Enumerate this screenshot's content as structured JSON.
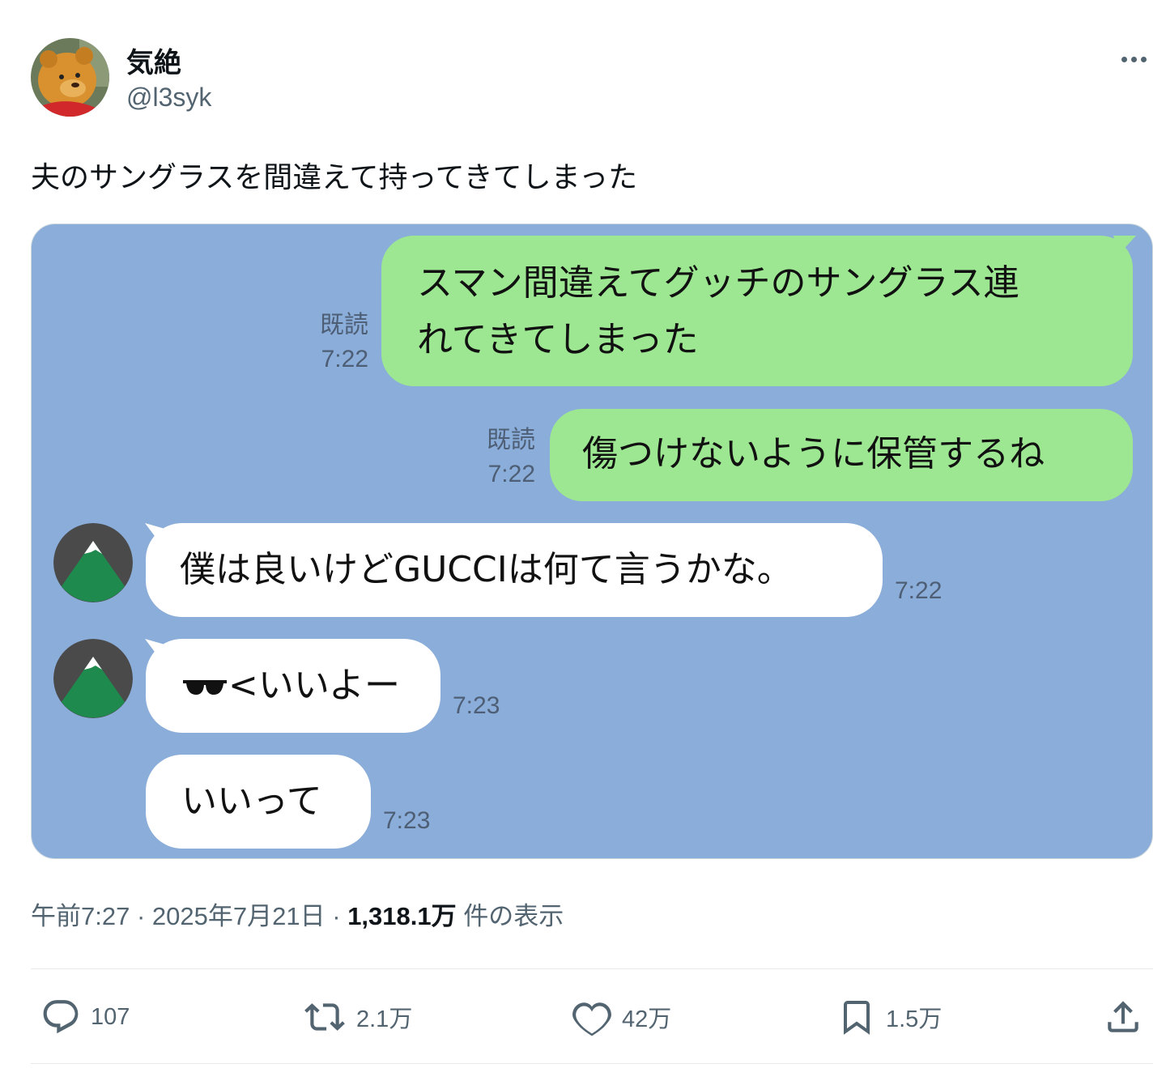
{
  "tweet": {
    "display_name": "気絶",
    "handle": "@l3syk",
    "text": "夫のサングラスを間違えて持ってきてしまった"
  },
  "chat": {
    "messages": [
      {
        "side": "right",
        "read": "既読",
        "time": "7:22",
        "line1": "スマン間違えてグッチのサングラス連",
        "line2": "れてきてしまった"
      },
      {
        "side": "right",
        "read": "既読",
        "time": "7:22",
        "text": "傷つけないように保管するね"
      },
      {
        "side": "left",
        "time": "7:22",
        "text": "僕は良いけどGUCCIは何て言うかな。"
      },
      {
        "side": "left",
        "time": "7:23",
        "text": "<いいよー",
        "emoji": "sunglasses"
      },
      {
        "side": "left",
        "time": "7:23",
        "text": "いいって"
      }
    ]
  },
  "meta": {
    "time": "午前7:27",
    "separator": "·",
    "date": "2025年7月21日",
    "views_count": "1,318.1万",
    "views_label": "件の表示"
  },
  "actions": {
    "reply_count": "107",
    "repost_count": "2.1万",
    "like_count": "42万",
    "bookmark_count": "1.5万"
  },
  "colors": {
    "line_bg": "#8badd9",
    "line_green": "#9de692",
    "text_secondary": "#536471"
  }
}
